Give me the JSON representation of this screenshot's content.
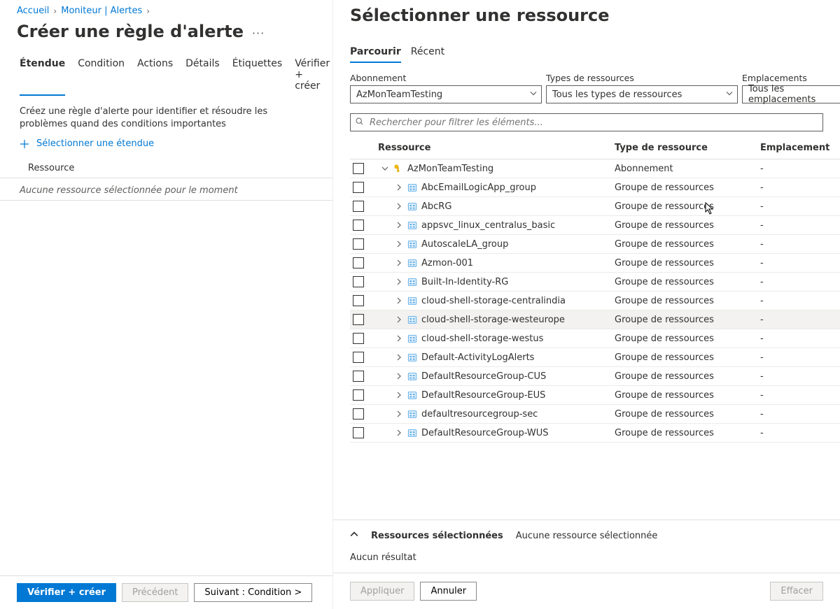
{
  "breadcrumb": {
    "home": "Accueil",
    "monitor": "Moniteur | Alertes"
  },
  "page": {
    "title": "Créer une règle d'alerte"
  },
  "tabs": {
    "scope": "Étendue",
    "condition": "Condition",
    "actions": "Actions",
    "details": "Détails",
    "tags": "Étiquettes",
    "review": "Vérifier + créer"
  },
  "intro": "Créez une règle d'alerte pour identifier et résoudre les problèmes quand des conditions importantes",
  "select_scope": "Sélectionner une étendue",
  "resource_header": "Ressource",
  "no_resource": "Aucune ressource sélectionnée pour le moment",
  "footer": {
    "verify": "Vérifier + créer",
    "prev": "Précédent",
    "next": "Suivant : Condition >"
  },
  "blade": {
    "title": "Sélectionner une ressource",
    "tab_browse": "Parcourir",
    "tab_recent": "Récent",
    "label_subscription": "Abonnement",
    "label_types": "Types de ressources",
    "label_locations": "Emplacements",
    "subscription": "AzMonTeamTesting",
    "types": "Tous les types de ressources",
    "locations": "Tous les emplacements",
    "search_placeholder": "Rechercher pour filtrer les éléments...",
    "col_resource": "Ressource",
    "col_type": "Type de ressource",
    "col_location": "Emplacement",
    "rows": [
      {
        "name": "AzMonTeamTesting",
        "type": "Abonnement",
        "location": "-",
        "top": true
      },
      {
        "name": "AbcEmailLogicApp_group",
        "type": "Groupe de ressources",
        "location": "-"
      },
      {
        "name": "AbcRG",
        "type": "Groupe de ressources",
        "location": "-"
      },
      {
        "name": "appsvc_linux_centralus_basic",
        "type": "Groupe de ressources",
        "location": "-"
      },
      {
        "name": "AutoscaleLA_group",
        "type": "Groupe de ressources",
        "location": "-"
      },
      {
        "name": "Azmon-001",
        "type": "Groupe de ressources",
        "location": "-"
      },
      {
        "name": "Built-In-Identity-RG",
        "type": "Groupe de ressources",
        "location": "-"
      },
      {
        "name": "cloud-shell-storage-centralindia",
        "type": "Groupe de ressources",
        "location": "-"
      },
      {
        "name": "cloud-shell-storage-westeurope",
        "type": "Groupe de ressources",
        "location": "-",
        "hovered": true
      },
      {
        "name": "cloud-shell-storage-westus",
        "type": "Groupe de ressources",
        "location": "-"
      },
      {
        "name": "Default-ActivityLogAlerts",
        "type": "Groupe de ressources",
        "location": "-"
      },
      {
        "name": "DefaultResourceGroup-CUS",
        "type": "Groupe de ressources",
        "location": "-"
      },
      {
        "name": "DefaultResourceGroup-EUS",
        "type": "Groupe de ressources",
        "location": "-"
      },
      {
        "name": "defaultresourcegroup-sec",
        "type": "Groupe de ressources",
        "location": "-"
      },
      {
        "name": "DefaultResourceGroup-WUS",
        "type": "Groupe de ressources",
        "location": "-"
      }
    ],
    "selected_label": "Ressources sélectionnées",
    "selected_none": "Aucune ressource sélectionnée",
    "no_result": "Aucun résultat",
    "apply": "Appliquer",
    "cancel": "Annuler",
    "clear": "Effacer"
  }
}
